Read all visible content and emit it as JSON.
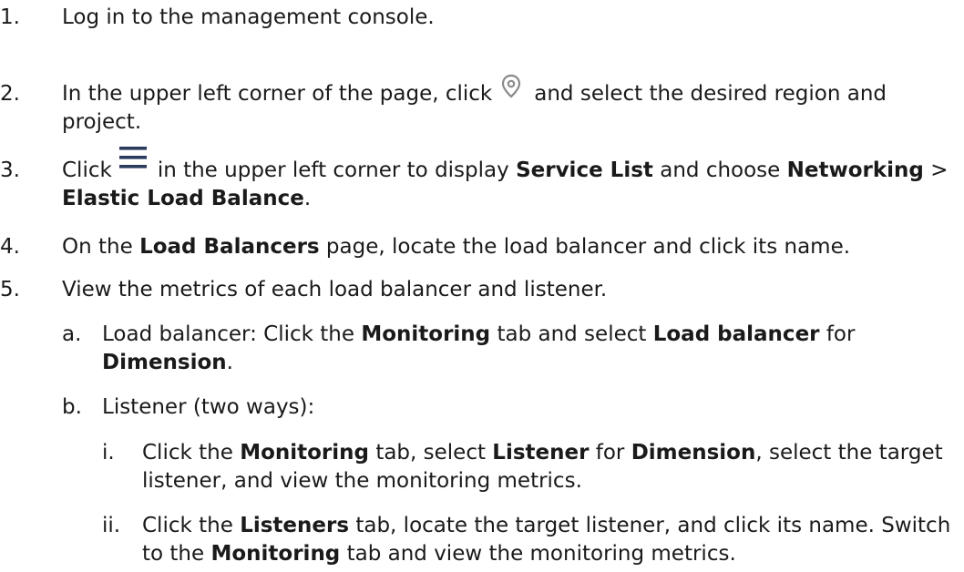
{
  "steps": [
    {
      "num": "1.",
      "parts": [
        "Log in to the management console."
      ]
    },
    {
      "num": "2.",
      "parts": [
        "In the upper left corner of the page, click",
        "and select the desired region and project."
      ]
    },
    {
      "num": "3.",
      "parts": [
        "Click",
        "in the upper left corner to display",
        "Service List",
        "and choose",
        "Networking",
        ">",
        "Elastic Load Balance",
        "."
      ]
    },
    {
      "num": "4.",
      "parts": [
        "On the",
        "Load Balancers",
        "page, locate the load balancer and click its name."
      ]
    },
    {
      "num": "5.",
      "parts": [
        "View the metrics of each load balancer and listener."
      ]
    }
  ],
  "substeps": [
    {
      "num": "a.",
      "parts": [
        "Load balancer: Click the",
        "Monitoring",
        "tab and select",
        "Load balancer",
        "for",
        "Dimension",
        "."
      ]
    },
    {
      "num": "b.",
      "parts": [
        "Listener (two ways):"
      ]
    }
  ],
  "subsubsteps": [
    {
      "num": "i.",
      "parts": [
        "Click the",
        "Monitoring",
        "tab, select",
        "Listener",
        "for",
        "Dimension",
        ", select the target listener, and view the monitoring metrics."
      ]
    },
    {
      "num": "ii.",
      "parts": [
        "Click the",
        "Listeners",
        "tab, locate the target listener, and click its name. Switch to the",
        "Monitoring",
        "tab and view the monitoring metrics."
      ]
    }
  ],
  "icons": {
    "region": "location-pin-icon",
    "menu": "hamburger-menu-icon"
  },
  "colors": {
    "text": "#1a1a1a",
    "icon_pin": "#8a8a8a",
    "icon_menu": "#2a3b5c"
  }
}
